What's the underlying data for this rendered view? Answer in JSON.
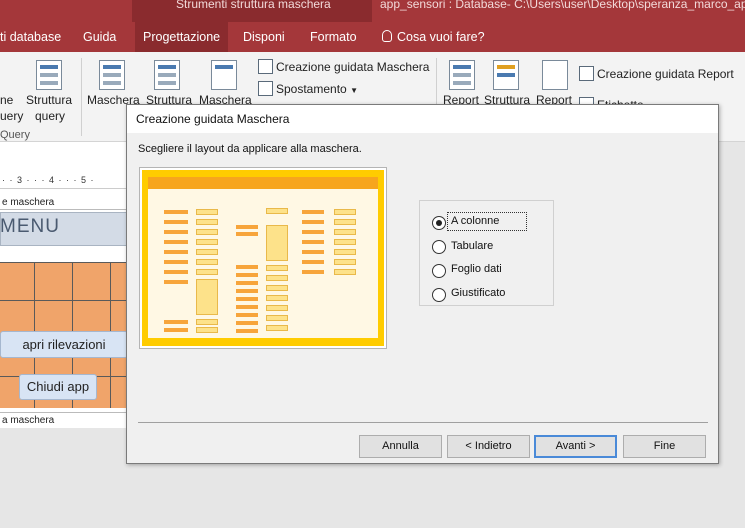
{
  "titlebar": {
    "context_tab": "Strumenti struttura maschera",
    "doc_title": "app_sensori : Database- C:\\Users\\user\\Desktop\\speranza_marco_app_"
  },
  "menu": {
    "items": [
      "ti database",
      "Guida",
      "Progettazione",
      "Disponi",
      "Formato"
    ],
    "tell_me": "Cosa vuoi fare?"
  },
  "ribbon": {
    "partial_1": "ne",
    "partial_2": "uery",
    "query_group": "Query",
    "struttura_query_1": "Struttura",
    "struttura_query_2": "query",
    "maschera": "Maschera",
    "struttura": "Struttura",
    "maschera_2": "Maschera",
    "creazione_guidata_maschera": "Creazione guidata Maschera",
    "spostamento": "Spostamento",
    "report": "Report",
    "struttura_report": "Struttura",
    "report_2": "Report",
    "creazione_guidata_report": "Creazione guidata Report",
    "etichette": "Etichette"
  },
  "designer": {
    "ruler": "· · 3 · · · 4 · · · 5 ·",
    "header_section": "e maschera",
    "menu_label": "MENU",
    "apri_button": "apri rilevazioni",
    "chiudi_button": "Chiudi app",
    "footer_section": "a maschera"
  },
  "dialog": {
    "title": "Creazione guidata Maschera",
    "instruction": "Scegliere il layout da applicare alla maschera.",
    "options": [
      {
        "label": "A colonne",
        "selected": true
      },
      {
        "label": "Tabulare",
        "selected": false
      },
      {
        "label": "Foglio dati",
        "selected": false
      },
      {
        "label": "Giustificato",
        "selected": false
      }
    ],
    "buttons": {
      "annulla": "Annulla",
      "indietro": "< Indietro",
      "avanti": "Avanti >",
      "fine": "Fine"
    }
  },
  "colors": {
    "access_red": "#a4373a",
    "preview_frame": "#ffcc00",
    "preview_accent": "#f7a53b",
    "grid_orange": "#f0a46a"
  }
}
